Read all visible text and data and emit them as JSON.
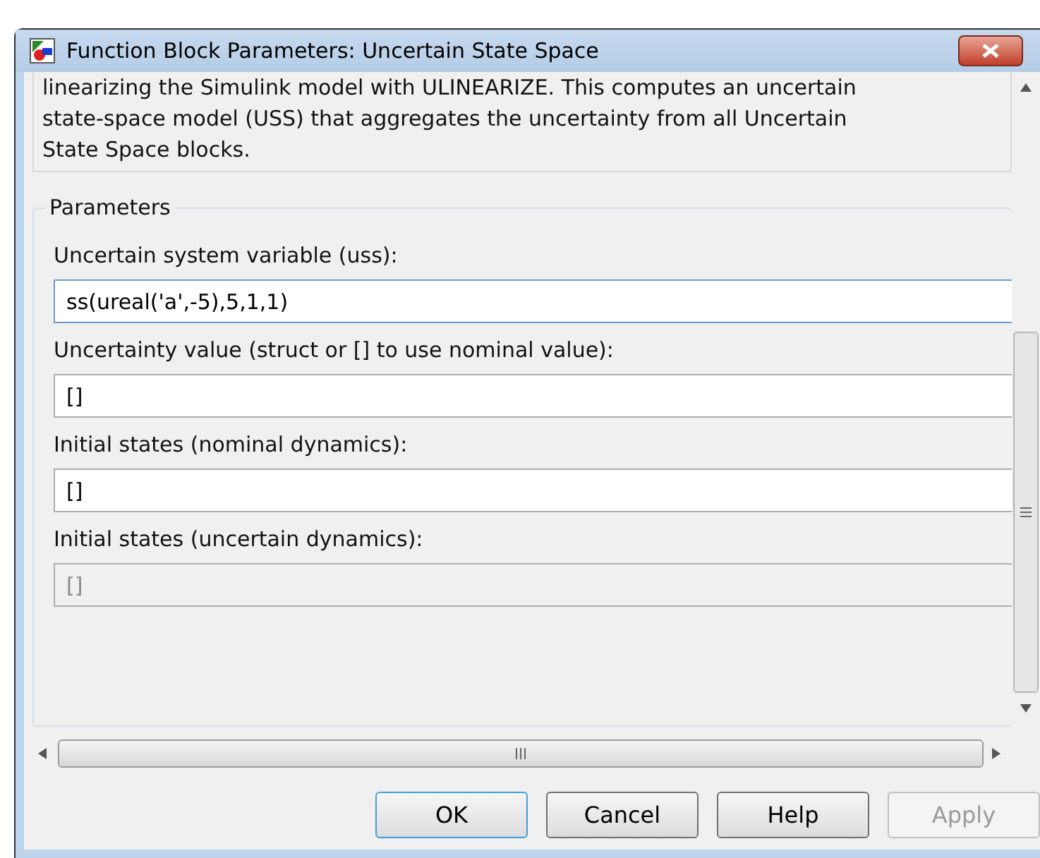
{
  "window": {
    "title": "Function Block Parameters: Uncertain State Space"
  },
  "description": [
    "linearizing the Simulink model with ULINEARIZE. This computes an uncertain",
    "state-space model (USS) that aggregates the uncertainty from all Uncertain",
    "State Space blocks."
  ],
  "parameters": {
    "title": "Parameters",
    "fields": [
      {
        "label": "Uncertain system variable (uss):",
        "value": "ss(ureal('a',-5),5,1,1)",
        "disabled": false,
        "focused": true
      },
      {
        "label": "Uncertainty value (struct or [] to use nominal value):",
        "value": "[]",
        "disabled": false,
        "focused": false
      },
      {
        "label": "Initial states (nominal dynamics):",
        "value": "[]",
        "disabled": false,
        "focused": false
      },
      {
        "label": "Initial states (uncertain dynamics):",
        "value": "[]",
        "disabled": true,
        "focused": false
      }
    ]
  },
  "buttons": [
    {
      "label": "OK",
      "default": true,
      "disabled": false
    },
    {
      "label": "Cancel",
      "default": false,
      "disabled": false
    },
    {
      "label": "Help",
      "default": false,
      "disabled": false
    },
    {
      "label": "Apply",
      "default": false,
      "disabled": true
    }
  ]
}
